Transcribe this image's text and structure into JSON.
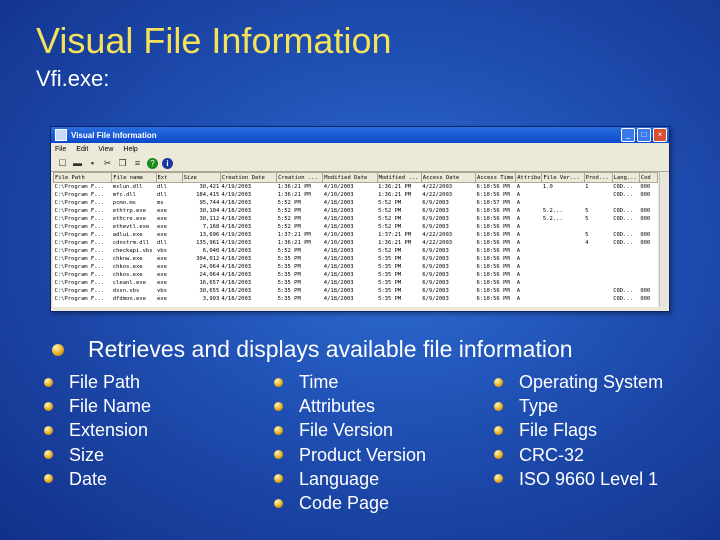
{
  "slide": {
    "title": "Visual File Information",
    "subtitle": "Vfi.exe:"
  },
  "window": {
    "title": "Visual File Information",
    "buttons": {
      "minimize": "_",
      "maximize": "□",
      "close": "×"
    },
    "menu": [
      "File",
      "Edit",
      "View",
      "Help"
    ],
    "toolbar_icons": [
      "checkbox-icon",
      "open-folder-icon",
      "save-icon",
      "cut-icon",
      "copy-icon",
      "copy-list-icon",
      "help-icon",
      "info-icon"
    ],
    "columns": [
      "File Path",
      "File name",
      "Ext",
      "Size",
      "Creation Date",
      "Creation ...",
      "Modified Date",
      "Modified ...",
      "Access Date",
      "Access Time",
      "Attributes",
      "File Ver...",
      "Prod...",
      "Lang...",
      "Cod"
    ],
    "rows": [
      [
        "C:\\Program F...",
        "mslun.dll",
        "dll",
        "30,421",
        "4/19/2003",
        "1:36:21 PM",
        "4/10/2003",
        "1:36:21 PM",
        "4/22/2003",
        "6:10:56 PM",
        "A",
        "1.0",
        "1",
        "C0D...",
        "000"
      ],
      [
        "C:\\Program F...",
        "mfc.dll",
        "dll",
        "184,415",
        "4/19/2003",
        "1:36:21 PM",
        "4/10/2003",
        "1:36:21 PM",
        "4/22/2003",
        "6:10:56 PM",
        "A",
        "",
        "",
        "C0D...",
        "000"
      ],
      [
        "C:\\Program F...",
        "pcmo.ms",
        "ms",
        "95,744",
        "4/18/2003",
        "5:52 PM",
        "4/18/2003",
        "5:52 PM",
        "6/9/2003",
        "6:10:57 PM",
        "A",
        "",
        "",
        "",
        ""
      ],
      [
        "C:\\Program F...",
        "ethtrp.exe",
        "exe",
        "30,104",
        "4/18/2003",
        "5:52 PM",
        "4/18/2003",
        "5:52 PM",
        "6/9/2003",
        "6:10:56 PM",
        "A",
        "5.2...",
        "5",
        "C0D...",
        "000"
      ],
      [
        "C:\\Program F...",
        "ethcre.exe",
        "exe",
        "30,112",
        "4/18/2003",
        "5:52 PM",
        "4/18/2003",
        "5:52 PM",
        "6/9/2003",
        "6:10:56 PM",
        "A",
        "5.2...",
        "5",
        "C0D...",
        "000"
      ],
      [
        "C:\\Program F...",
        "ethevtl.exe",
        "exe",
        "7,168",
        "4/18/2003",
        "5:52 PM",
        "4/18/2003",
        "5:52 PM",
        "6/9/2003",
        "6:10:56 PM",
        "A",
        "",
        "",
        "",
        ""
      ],
      [
        "C:\\Program F...",
        "adlui.exe",
        "exe",
        "13,696",
        "4/19/2003",
        "1:37:21 PM",
        "4/10/2003",
        "1:37:21 PM",
        "4/22/2003",
        "6:10:56 PM",
        "A",
        "",
        "5",
        "C0D...",
        "000"
      ],
      [
        "C:\\Program F...",
        "cdnstrm.dll",
        "dll",
        "135,961",
        "4/19/2003",
        "1:36:21 PM",
        "4/10/2003",
        "1:36:21 PM",
        "4/22/2003",
        "6:10:56 PM",
        "A",
        "",
        "4",
        "C0D...",
        "000"
      ],
      [
        "C:\\Program F...",
        "checkapi.vbs",
        "vbs",
        "6,040",
        "4/18/2003",
        "5:52 PM",
        "4/18/2003",
        "5:52 PM",
        "6/9/2003",
        "6:10:56 PM",
        "A",
        "",
        "",
        "",
        ""
      ],
      [
        "C:\\Program F...",
        "chknw.exe",
        "exe",
        "304,012",
        "4/18/2003",
        "5:35 PM",
        "4/18/2003",
        "5:35 PM",
        "6/9/2003",
        "6:10:56 PM",
        "A",
        "",
        "",
        "",
        ""
      ],
      [
        "C:\\Program F...",
        "chkos.exe",
        "exe",
        "24,064",
        "4/18/2003",
        "5:35 PM",
        "4/18/2003",
        "5:35 PM",
        "6/9/2003",
        "6:10:56 PM",
        "A",
        "",
        "",
        "",
        ""
      ],
      [
        "C:\\Program F...",
        "chkos.exe",
        "exe",
        "24,064",
        "4/18/2003",
        "5:35 PM",
        "4/18/2003",
        "5:35 PM",
        "6/9/2003",
        "6:10:56 PM",
        "A",
        "",
        "",
        "",
        ""
      ],
      [
        "C:\\Program F...",
        "cleanl.exe",
        "exe",
        "16,657",
        "4/18/2003",
        "5:35 PM",
        "4/18/2003",
        "5:35 PM",
        "6/9/2003",
        "6:10:56 PM",
        "A",
        "",
        "",
        "",
        ""
      ],
      [
        "C:\\Program F...",
        "dssn.vbs",
        "vbs",
        "30,655",
        "4/18/2003",
        "5:35 PM",
        "4/18/2003",
        "5:35 PM",
        "6/9/2003",
        "6:10:56 PM",
        "A",
        "",
        "",
        "C0D...",
        "000"
      ],
      [
        "C:\\Program F...",
        "dfdmon.exe",
        "exe",
        "3,993",
        "4/18/2003",
        "5:35 PM",
        "4/18/2003",
        "5:35 PM",
        "6/9/2003",
        "6:10:56 PM",
        "A",
        "",
        "",
        "C0D...",
        "000"
      ]
    ]
  },
  "bullets": {
    "main": "Retrieves and displays available file information",
    "col1": [
      "File Path",
      "File Name",
      "Extension",
      "Size",
      "Date"
    ],
    "col2": [
      "Time",
      "Attributes",
      "File Version",
      "Product Version",
      "Language",
      "Code Page"
    ],
    "col3": [
      "Operating System",
      "Type",
      "File Flags",
      "CRC-32",
      "ISO 9660 Level 1"
    ]
  }
}
